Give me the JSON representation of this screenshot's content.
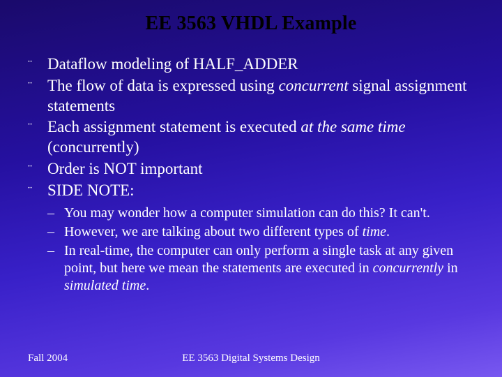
{
  "title": "EE 3563 VHDL Example",
  "bullets": {
    "b1": {
      "pre": "Dataflow modeling of HALF_ADDER"
    },
    "b2": {
      "pre": "The flow of data is expressed using ",
      "em": "concurrent",
      "post": " signal assignment statements"
    },
    "b3": {
      "pre": "Each assignment statement is executed ",
      "em": "at the same time",
      "post": " (concurrently)"
    },
    "b4": {
      "pre": "Order is NOT important"
    },
    "b5": {
      "pre": "SIDE NOTE:"
    }
  },
  "sub": {
    "s1": {
      "pre": "You may wonder how a computer simulation can do this?  It can't."
    },
    "s2": {
      "pre": "However, we are talking about two different types of ",
      "em": "time",
      "post": "."
    },
    "s3": {
      "pre": "In real-time, the computer can only perform a single task at any given point, but here we mean the statements are executed in ",
      "em": "concurrently",
      "post": " in ",
      "em2": "simulated time",
      "post2": "."
    }
  },
  "footer": {
    "left": "Fall 2004",
    "center": "EE 3563 Digital Systems Design"
  },
  "glyphs": {
    "diamond": "¨",
    "dash": "–"
  }
}
